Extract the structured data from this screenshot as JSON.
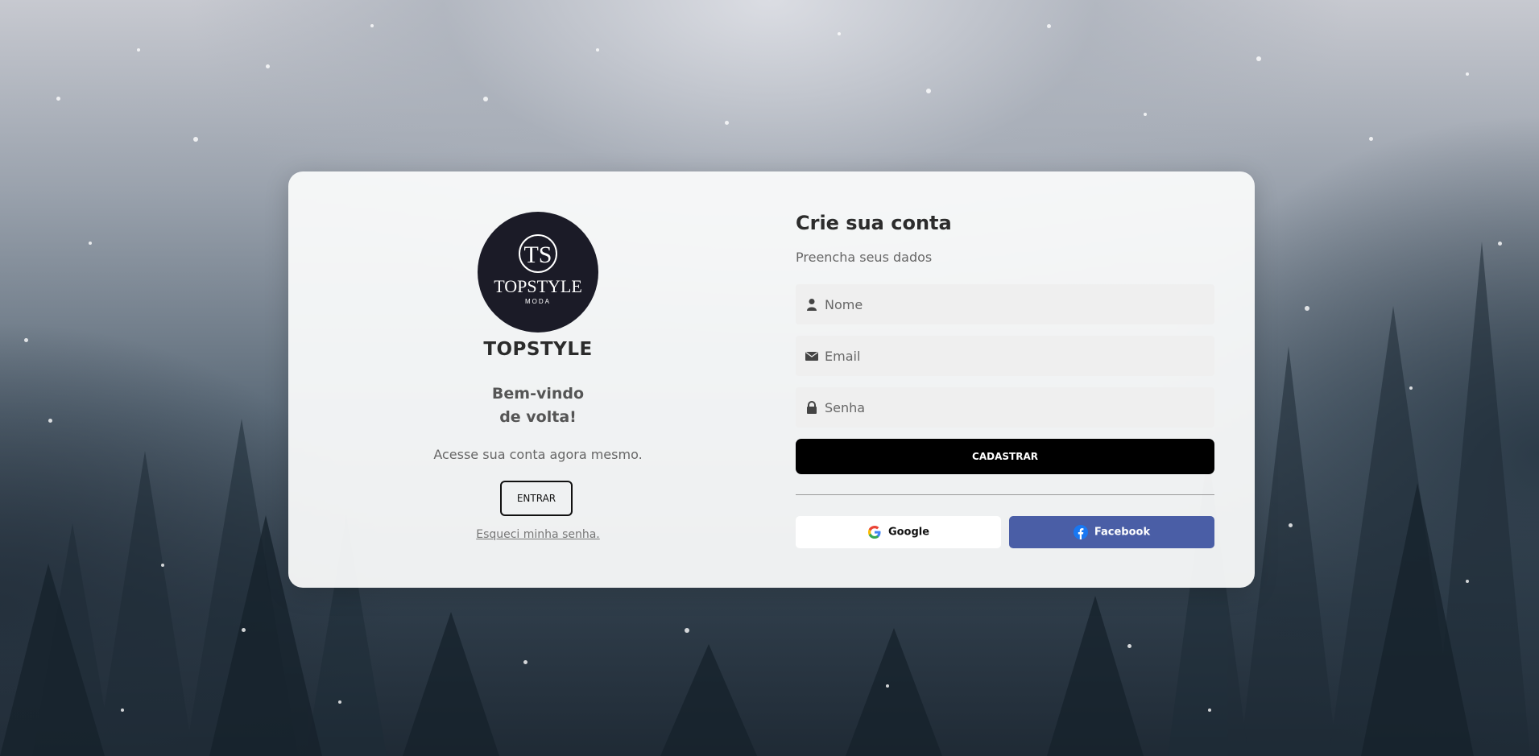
{
  "left_panel": {
    "logo": {
      "monogram": "TS",
      "wordmark": "TOPSTYLE",
      "tagline": "MODA"
    },
    "brand_name": "TOPSTYLE",
    "welcome_line1": "Bem-vindo",
    "welcome_line2": "de volta!",
    "subtitle": "Acesse sua conta agora mesmo.",
    "enter_button": "ENTRAR",
    "forgot_link": "Esqueci minha senha."
  },
  "right_panel": {
    "title": "Crie sua conta",
    "subtitle": "Preencha seus dados",
    "fields": [
      {
        "icon": "user-icon",
        "placeholder": "Nome",
        "value": ""
      },
      {
        "icon": "envelope-icon",
        "placeholder": "Email",
        "value": ""
      },
      {
        "icon": "lock-icon",
        "placeholder": "Senha",
        "value": ""
      }
    ],
    "register_button": "CADASTRAR",
    "social": {
      "google_label": "Google",
      "facebook_label": "Facebook"
    }
  },
  "colors": {
    "card_bg": "#fafbfb",
    "primary_button": "#000000",
    "facebook_blue": "#4a5ea6",
    "logo_bg": "#1b1b27"
  }
}
